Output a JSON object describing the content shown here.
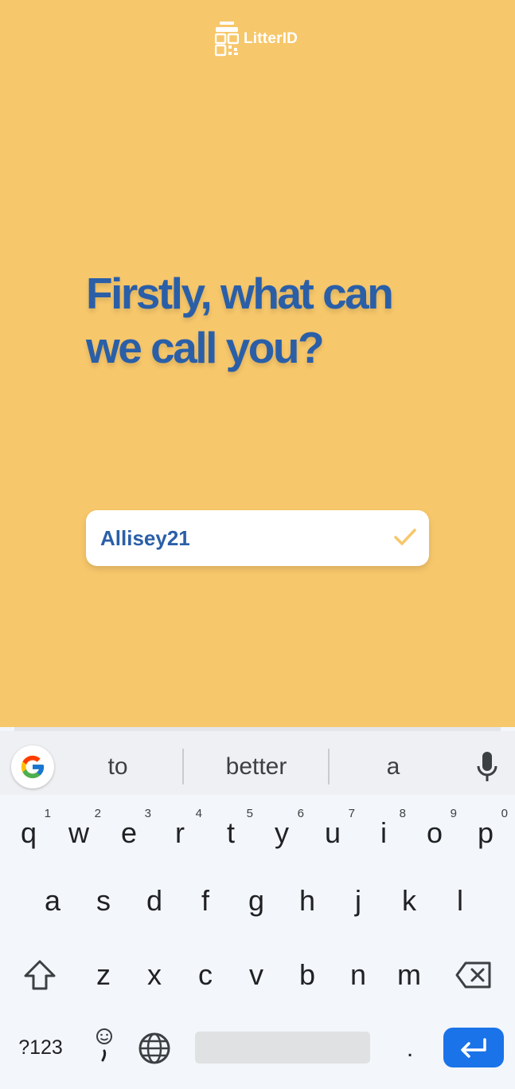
{
  "app": {
    "logo_text": "LitterID",
    "headline_line1": "Firstly, what can",
    "headline_line2": "we call you?",
    "name_value": "Allisey21",
    "colors": {
      "background": "#f7c76b",
      "headline": "#2a5fa8",
      "check": "#f7c76b"
    }
  },
  "keyboard": {
    "suggestions": [
      "to",
      "better",
      "a"
    ],
    "row1": [
      {
        "key": "q",
        "hint": "1"
      },
      {
        "key": "w",
        "hint": "2"
      },
      {
        "key": "e",
        "hint": "3"
      },
      {
        "key": "r",
        "hint": "4"
      },
      {
        "key": "t",
        "hint": "5"
      },
      {
        "key": "y",
        "hint": "6"
      },
      {
        "key": "u",
        "hint": "7"
      },
      {
        "key": "i",
        "hint": "8"
      },
      {
        "key": "o",
        "hint": "9"
      },
      {
        "key": "p",
        "hint": "0"
      }
    ],
    "row2": [
      "a",
      "s",
      "d",
      "f",
      "g",
      "h",
      "j",
      "k",
      "l"
    ],
    "row3": [
      "z",
      "x",
      "c",
      "v",
      "b",
      "n",
      "m"
    ],
    "symbols_label": "?123",
    "period_label": ".",
    "icons": [
      "google-icon",
      "microphone-icon",
      "shift-icon",
      "backspace-icon",
      "emoji-icon",
      "globe-icon",
      "enter-icon"
    ],
    "accent": "#1a73e8"
  }
}
